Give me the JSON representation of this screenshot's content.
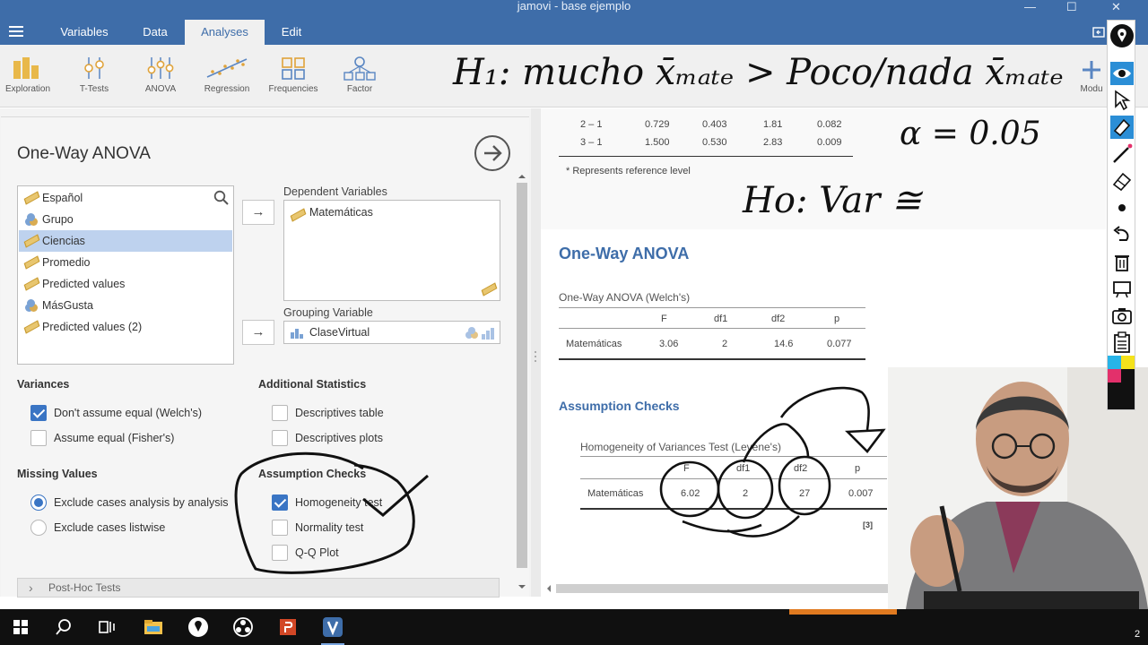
{
  "window": {
    "title": "jamovi - base ejemplo",
    "minimize": "—",
    "maximize": "☐",
    "close": "✕"
  },
  "tabs": [
    {
      "label": "Variables"
    },
    {
      "label": "Data"
    },
    {
      "label": "Analyses"
    },
    {
      "label": "Edit"
    }
  ],
  "ribbon": {
    "items": [
      {
        "label": "Exploration"
      },
      {
        "label": "T-Tests"
      },
      {
        "label": "ANOVA"
      },
      {
        "label": "Regression"
      },
      {
        "label": "Frequencies"
      },
      {
        "label": "Factor"
      }
    ],
    "modules_label": "Modu"
  },
  "analysis": {
    "title": "One-Way ANOVA",
    "variables": [
      {
        "name": "Español",
        "type": "continuous"
      },
      {
        "name": "Grupo",
        "type": "nominal"
      },
      {
        "name": "Ciencias",
        "type": "continuous",
        "selected": true
      },
      {
        "name": "Promedio",
        "type": "continuous"
      },
      {
        "name": "Predicted values",
        "type": "continuous"
      },
      {
        "name": "MásGusta",
        "type": "nominal"
      },
      {
        "name": "Predicted values (2)",
        "type": "continuous"
      }
    ],
    "move_arrow": "→",
    "dependent_label": "Dependent Variables",
    "dependent_value": "Matemáticas",
    "grouping_label": "Grouping Variable",
    "grouping_value": "ClaseVirtual",
    "variances": {
      "heading": "Variances",
      "options": [
        {
          "label": "Don't assume equal (Welch's)",
          "checked": true
        },
        {
          "label": "Assume equal (Fisher's)",
          "checked": false
        }
      ]
    },
    "additional": {
      "heading": "Additional Statistics",
      "options": [
        {
          "label": "Descriptives table",
          "checked": false
        },
        {
          "label": "Descriptives plots",
          "checked": false
        }
      ]
    },
    "missing": {
      "heading": "Missing Values",
      "options": [
        {
          "label": "Exclude cases analysis by analysis",
          "checked": true
        },
        {
          "label": "Exclude cases listwise",
          "checked": false
        }
      ]
    },
    "assumption": {
      "heading": "Assumption Checks",
      "options": [
        {
          "label": "Homogeneity test",
          "checked": true
        },
        {
          "label": "Normality test",
          "checked": false
        },
        {
          "label": "Q-Q Plot",
          "checked": false
        }
      ]
    },
    "posthoc_label": "Post-Hoc Tests",
    "expand_glyph": "›"
  },
  "results": {
    "prev_rows": [
      {
        "comp": "2 – 1",
        "v1": "0.729",
        "v2": "0.403",
        "v3": "1.81",
        "v4": "0.082"
      },
      {
        "comp": "3 – 1",
        "v1": "1.500",
        "v2": "0.530",
        "v3": "2.83",
        "v4": "0.009"
      }
    ],
    "prev_note": "* Represents reference level",
    "anova_title": "One-Way ANOVA",
    "welch_caption": "One-Way ANOVA (Welch's)",
    "welch_headers": [
      "",
      "F",
      "df1",
      "df2",
      "p"
    ],
    "welch_row": [
      "Matemáticas",
      "3.06",
      "2",
      "14.6",
      "0.077"
    ],
    "assumption_title": "Assumption Checks",
    "levene_caption": "Homogeneity of Variances Test (Levene's)",
    "levene_headers": [
      "",
      "F",
      "df1",
      "df2",
      "p"
    ],
    "levene_row": [
      "Matemáticas",
      "6.02",
      "2",
      "27",
      "0.007"
    ],
    "ref_tag": "[3]"
  },
  "handwriting": {
    "line1": "H₁: mucho x̄ₘₐₜₑ > Poco/nada x̄ₘₐₜₑ",
    "line2": "α = 0.05",
    "line3": "Ho: Var ≅"
  },
  "taskbar": {
    "clock_fragment": "2"
  },
  "colors": {
    "brand": "#3e6da9",
    "checkbox": "#3a75c4",
    "selection": "#bed2ee"
  }
}
